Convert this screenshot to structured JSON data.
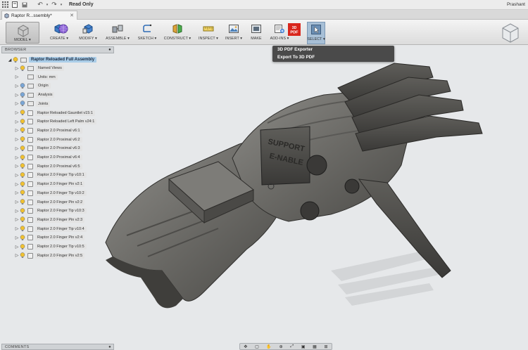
{
  "titlebar": {
    "read_only": "Read Only",
    "user": "Prashant"
  },
  "document_tab": {
    "title": "Raptor R...ssembly*"
  },
  "ribbon": {
    "workspace": "MODEL",
    "tools": [
      {
        "label": "CREATE ▾",
        "icon": "create-icon"
      },
      {
        "label": "MODIFY ▾",
        "icon": "modify-icon"
      },
      {
        "label": "ASSEMBLE ▾",
        "icon": "assemble-icon"
      },
      {
        "label": "SKETCH ▾",
        "icon": "sketch-icon"
      },
      {
        "label": "CONSTRUCT ▾",
        "icon": "construct-icon"
      },
      {
        "label": "INSPECT ▾",
        "icon": "inspect-icon"
      },
      {
        "label": "INSERT ▾",
        "icon": "insert-icon"
      },
      {
        "label": "MAKE",
        "icon": "make-icon"
      },
      {
        "label": "ADD-INS ▾",
        "icon": "addins-icon"
      },
      {
        "label": "SELECT ▾",
        "icon": "select-icon"
      }
    ]
  },
  "addins_menu": {
    "items": [
      "3D PDF Exporter",
      "Export To 3D PDF"
    ]
  },
  "browser": {
    "title": "BROWSER",
    "root": "Raptor Reloaded Full Assembly",
    "items": [
      {
        "label": "Named Views",
        "kind": "folder"
      },
      {
        "label": "Units: mm",
        "kind": "units"
      },
      {
        "label": "Origin",
        "kind": "folder"
      },
      {
        "label": "Analysis",
        "kind": "folder"
      },
      {
        "label": "Joints",
        "kind": "folder"
      },
      {
        "label": "Raptor Reloaded Gauntlet v15:1",
        "kind": "component"
      },
      {
        "label": "Raptor Reloaded Left Palm v24:1",
        "kind": "component"
      },
      {
        "label": "Raptor 2.0 Proximal v6:1",
        "kind": "component"
      },
      {
        "label": "Raptor 2.0 Proximal v6:2",
        "kind": "component"
      },
      {
        "label": "Raptor 2.0 Proximal v6:3",
        "kind": "component"
      },
      {
        "label": "Raptor 2.0 Proximal v6:4",
        "kind": "component"
      },
      {
        "label": "Raptor 2.0 Proximal v6:5",
        "kind": "component"
      },
      {
        "label": "Raptor 2.0 Finger Tip v10:1",
        "kind": "component"
      },
      {
        "label": "Raptor 2.0 Finger Pin v2:1",
        "kind": "component"
      },
      {
        "label": "Raptor 2.0 Finger Tip v10:2",
        "kind": "component"
      },
      {
        "label": "Raptor 2.0 Finger Pin v2:2",
        "kind": "component"
      },
      {
        "label": "Raptor 2.0 Finger Tip v10:3",
        "kind": "component"
      },
      {
        "label": "Raptor 2.0 Finger Pin v2:3",
        "kind": "component"
      },
      {
        "label": "Raptor 2.0 Finger Tip v10:4",
        "kind": "component"
      },
      {
        "label": "Raptor 2.0 Finger Pin v2:4",
        "kind": "component"
      },
      {
        "label": "Raptor 2.0 Finger Tip v10:5",
        "kind": "component"
      },
      {
        "label": "Raptor 2.0 Finger Pin v2:5",
        "kind": "component"
      }
    ]
  },
  "model_text": {
    "line1": "SUPPORT",
    "line2": "E-NABLE"
  },
  "comments": {
    "title": "COMMENTS"
  },
  "colors": {
    "accent": "#aacde8",
    "pdf_red": "#d9261c",
    "model_gray": "#6e6d6a"
  }
}
